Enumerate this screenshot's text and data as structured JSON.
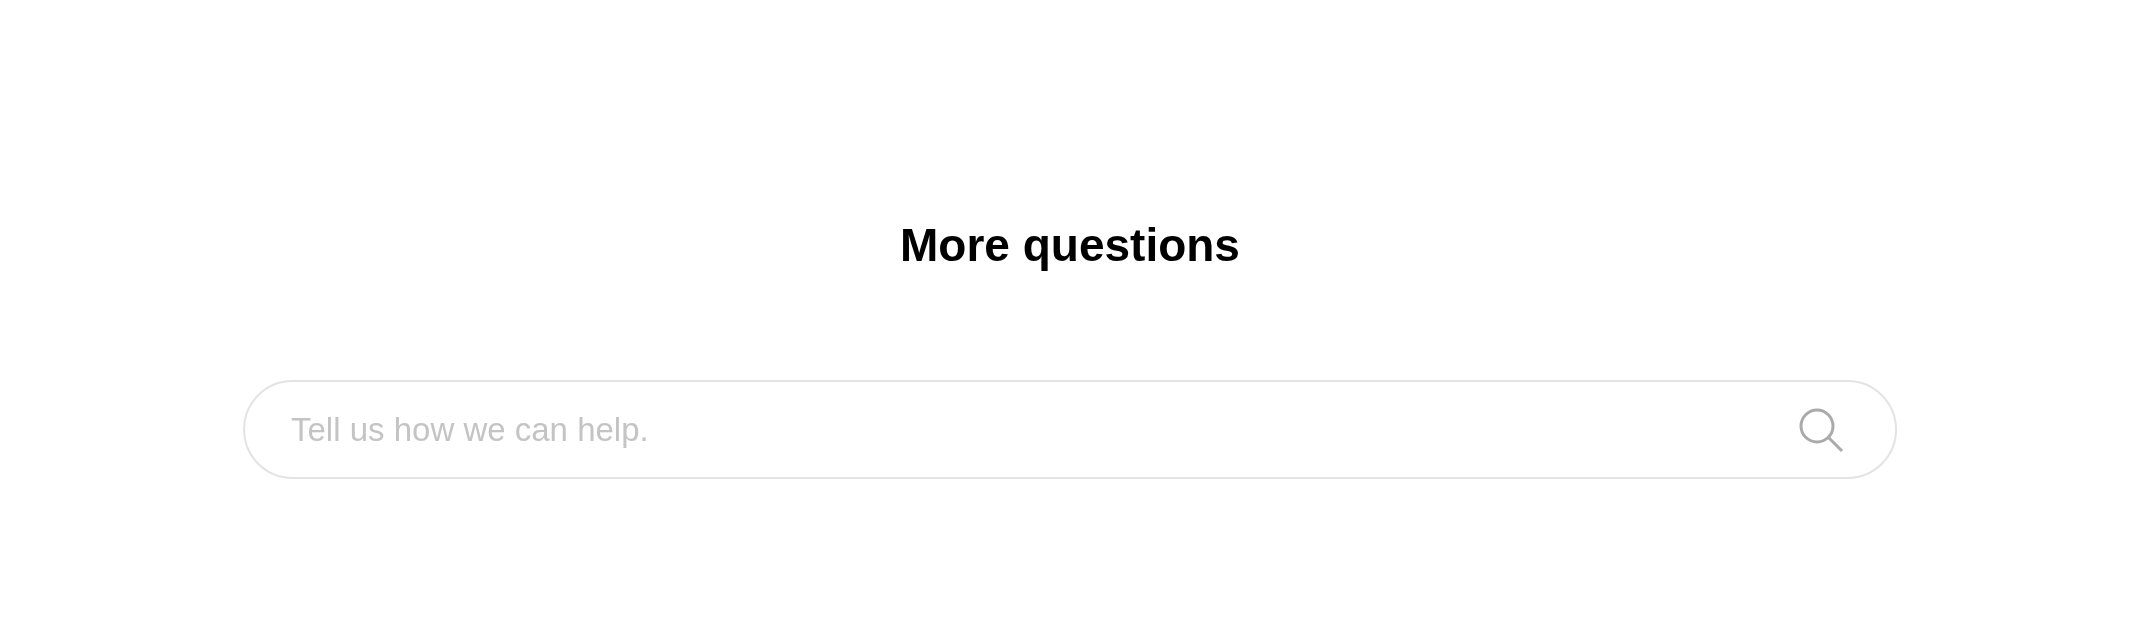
{
  "heading": "More questions",
  "search": {
    "placeholder": "Tell us how we can help."
  }
}
